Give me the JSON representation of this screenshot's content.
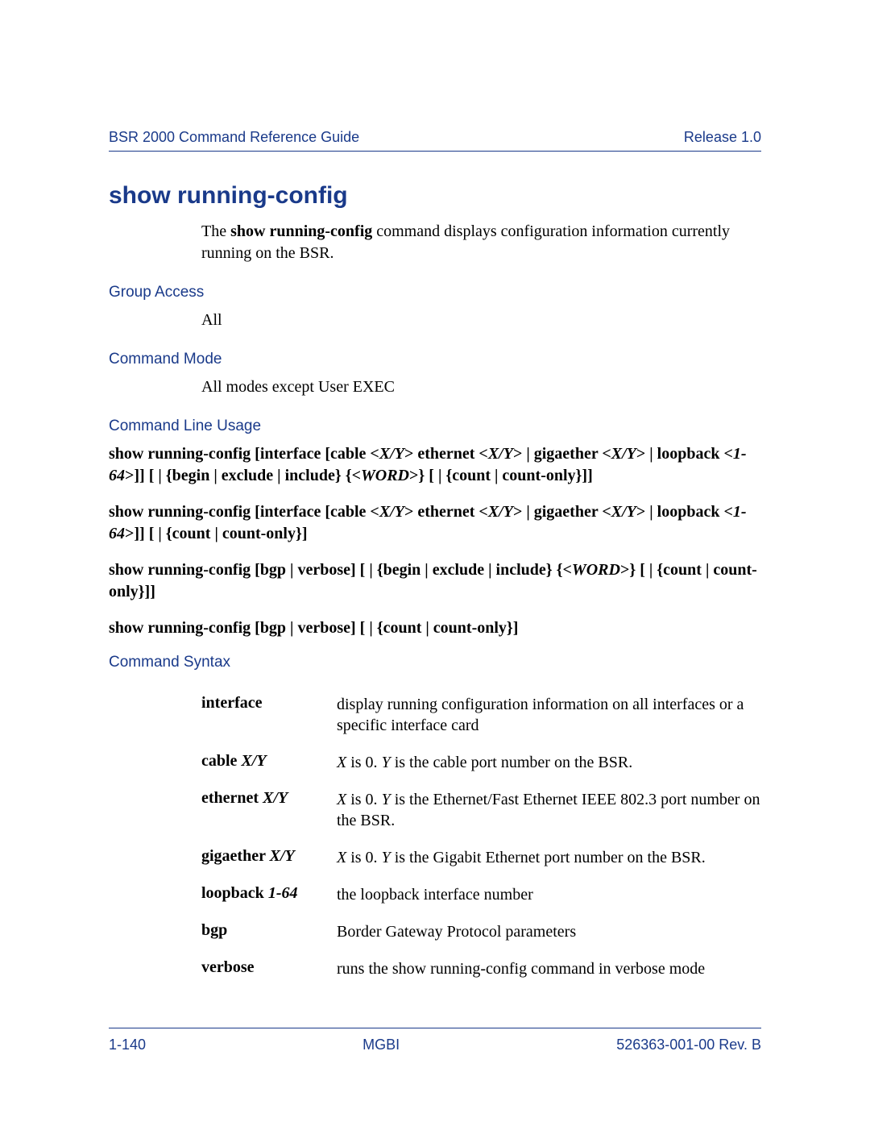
{
  "header": {
    "left": "BSR 2000 Command Reference Guide",
    "right": "Release 1.0"
  },
  "title": "show running-config",
  "intro_pre": "The ",
  "intro_cmd": "show running-config",
  "intro_post": " command displays configuration information currently running on the BSR.",
  "sections": {
    "group_access": {
      "head": "Group Access",
      "value": "All"
    },
    "command_mode": {
      "head": "Command Mode",
      "value": "All modes except User EXEC"
    },
    "cli_usage_head": "Command Line Usage",
    "usage1": {
      "a": "show running-config [interface [cable <",
      "xy1": "X/Y",
      "b": "> ethernet <",
      "xy2": "X/Y",
      "c": "> | gigaether <",
      "xy3": "X/Y",
      "d": "> | loopback <",
      "rng": "1-64",
      "e": ">]] [ | {begin | exclude | include} {<",
      "w": "WORD",
      "f": ">} [ | {count | count-only}]]"
    },
    "usage2": {
      "a": "show running-config [interface [cable <",
      "xy1": "X/Y",
      "b": "> ethernet <",
      "xy2": "X/Y",
      "c": "> | gigaether <",
      "xy3": "X/Y",
      "d": "> | loopback <",
      "rng": "1-64",
      "e": ">]] [ | {count | count-only}]"
    },
    "usage3": {
      "a": "show running-config [bgp | verbose] [ | {begin | exclude | include} {<",
      "w": "WORD",
      "b": ">} [ | {count | count-only}]]"
    },
    "usage4": "show running-config [bgp | verbose] [ | {count | count-only}]",
    "syntax_head": "Command Syntax",
    "syntax": [
      {
        "term": "interface",
        "term_i": "",
        "desc_pre": "display running configuration information on all interfaces or a specific interface card",
        "desc_i1": "",
        "desc_mid": "",
        "desc_i2": "",
        "desc_post": ""
      },
      {
        "term": "cable ",
        "term_i": "X/Y",
        "desc_pre": "",
        "desc_i1": "X",
        "desc_mid": " is 0. ",
        "desc_i2": "Y",
        "desc_post": " is the cable port number on the BSR."
      },
      {
        "term": "ethernet ",
        "term_i": "X/Y",
        "desc_pre": "",
        "desc_i1": "X",
        "desc_mid": " is 0. ",
        "desc_i2": "Y",
        "desc_post": " is the Ethernet/Fast Ethernet IEEE 802.3 port number on the BSR."
      },
      {
        "term": "gigaether ",
        "term_i": "X/Y",
        "desc_pre": "",
        "desc_i1": "X",
        "desc_mid": " is 0. ",
        "desc_i2": "Y",
        "desc_post": " is the Gigabit Ethernet port number on the BSR."
      },
      {
        "term": "loopback ",
        "term_i": "1-64",
        "desc_pre": "the loopback interface number",
        "desc_i1": "",
        "desc_mid": "",
        "desc_i2": "",
        "desc_post": ""
      },
      {
        "term": "bgp",
        "term_i": "",
        "desc_pre": "Border Gateway Protocol parameters",
        "desc_i1": "",
        "desc_mid": "",
        "desc_i2": "",
        "desc_post": ""
      },
      {
        "term": "verbose",
        "term_i": "",
        "desc_pre": "runs the show running-config command in verbose mode",
        "desc_i1": "",
        "desc_mid": "",
        "desc_i2": "",
        "desc_post": ""
      }
    ]
  },
  "footer": {
    "left": "1-140",
    "center": "MGBI",
    "right": "526363-001-00 Rev. B"
  }
}
